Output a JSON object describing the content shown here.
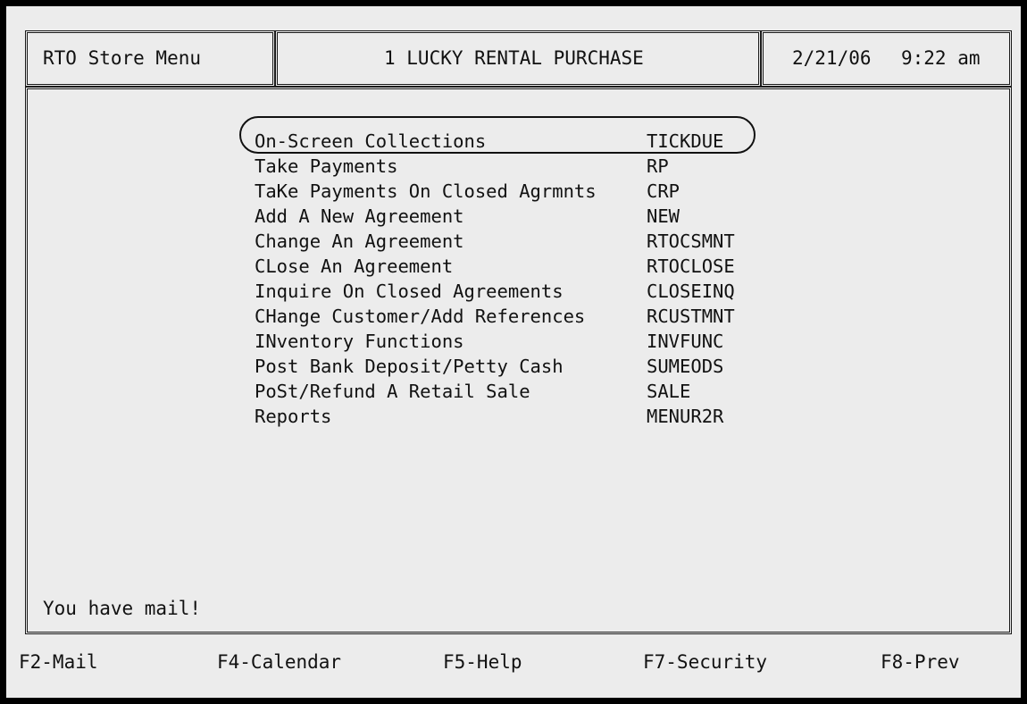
{
  "header": {
    "menu_title": "RTO Store Menu",
    "store_name": "1 LUCKY RENTAL PURCHASE",
    "date": "2/21/06",
    "time": "9:22 am"
  },
  "menu": {
    "items": [
      {
        "label": "On-Screen Collections",
        "code": "TICKDUE",
        "highlighted": true
      },
      {
        "label": "Take Payments",
        "code": "RP"
      },
      {
        "label": "TaKe Payments On Closed Agrmnts",
        "code": "CRP"
      },
      {
        "label": "Add A New Agreement",
        "code": "NEW"
      },
      {
        "label": "Change An Agreement",
        "code": "RTOCSMNT"
      },
      {
        "label": "CLose An Agreement",
        "code": "RTOCLOSE"
      },
      {
        "label": "Inquire On Closed Agreements",
        "code": "CLOSEINQ"
      },
      {
        "label": "CHange Customer/Add References",
        "code": "RCUSTMNT"
      },
      {
        "label": "INventory Functions",
        "code": "INVFUNC"
      },
      {
        "label": "Post Bank Deposit/Petty Cash",
        "code": "SUMEODS"
      },
      {
        "label": "PoSt/Refund A Retail Sale",
        "code": "SALE"
      },
      {
        "label": "Reports",
        "code": "MENUR2R"
      }
    ]
  },
  "status": {
    "message": "You have mail!"
  },
  "function_keys": [
    {
      "label": "F2-Mail"
    },
    {
      "label": "F4-Calendar"
    },
    {
      "label": "F5-Help"
    },
    {
      "label": "F7-Security"
    },
    {
      "label": "F8-Prev"
    }
  ]
}
